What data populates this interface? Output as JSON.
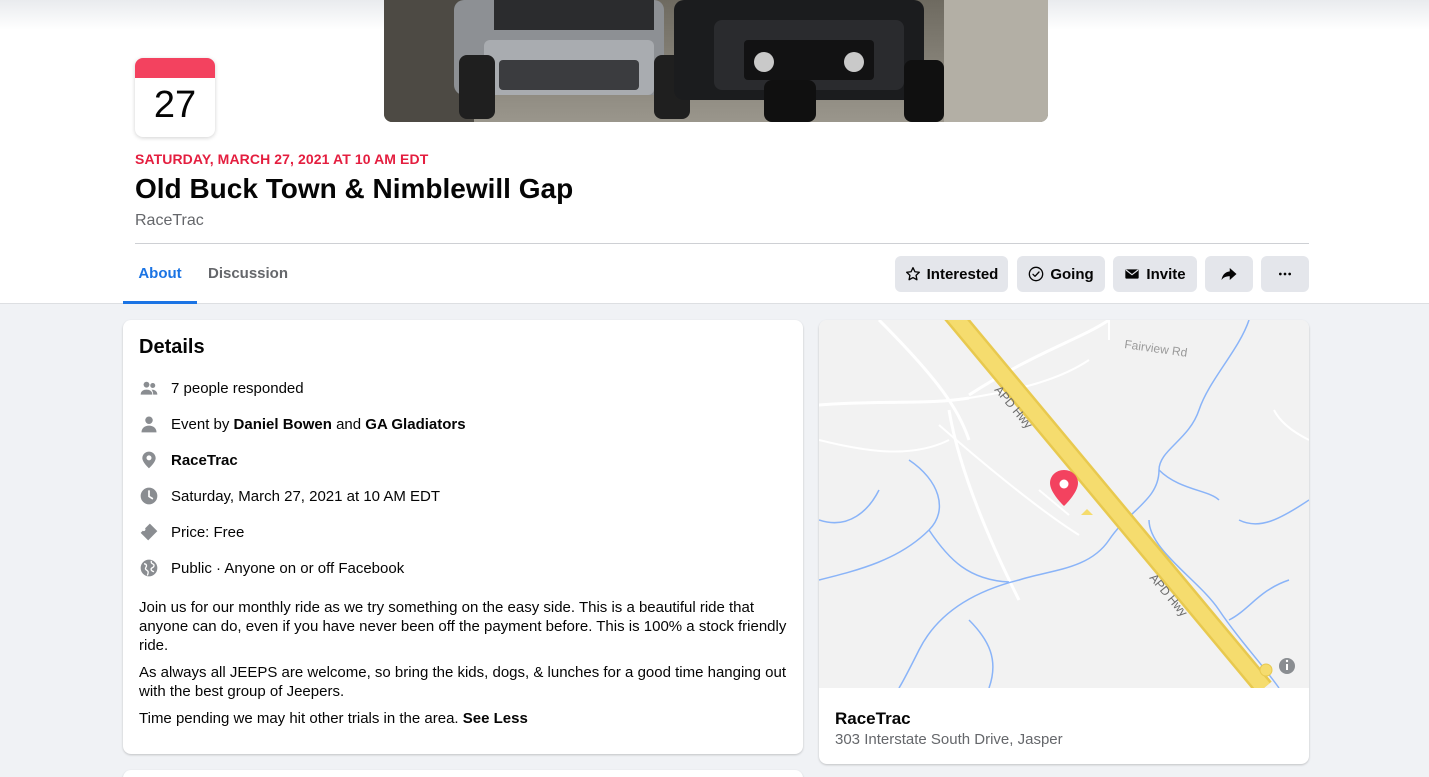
{
  "calendar": {
    "day": "27"
  },
  "event": {
    "date_line": "SATURDAY, MARCH 27, 2021 AT 10 AM EDT",
    "title": "Old Buck Town & Nimblewill Gap",
    "location": "RaceTrac"
  },
  "tabs": [
    {
      "label": "About",
      "active": true
    },
    {
      "label": "Discussion",
      "active": false
    }
  ],
  "actions": {
    "interested": "Interested",
    "going": "Going",
    "invite": "Invite",
    "share_icon": "share-arrow-icon",
    "more_icon": "more-dots-icon"
  },
  "details": {
    "heading": "Details",
    "responded": "7 people responded",
    "event_by_prefix": "Event by",
    "host1": "Daniel Bowen",
    "and": "and",
    "host2": "GA Gladiators",
    "place": "RaceTrac",
    "datetime": "Saturday, March 27, 2021 at 10 AM EDT",
    "price": "Price: Free",
    "privacy": "Public · Anyone on or off Facebook",
    "description": [
      "Join us for our monthly ride as we try something on the easy side. This is a beautiful ride that anyone can do, even if you have never been off the payment before. This is 100% a stock friendly ride.",
      "As always all JEEPS are welcome, so bring the kids, dogs, & lunches for a good time hanging out with the best group of Jeepers.",
      "Time pending we may hit other trials in the area."
    ],
    "see_less": "See Less"
  },
  "map": {
    "road_label_1": "Fairview Rd",
    "road_label_2": "APD Hwy",
    "road_label_3": "APD Hwy",
    "place_name": "RaceTrac",
    "address": "303 Interstate South Drive, Jasper"
  },
  "colors": {
    "accent_blue": "#1b74e4",
    "date_red": "#e41e3f",
    "pin_red": "#f3425f",
    "highway_yellow": "#f5dc6e"
  }
}
